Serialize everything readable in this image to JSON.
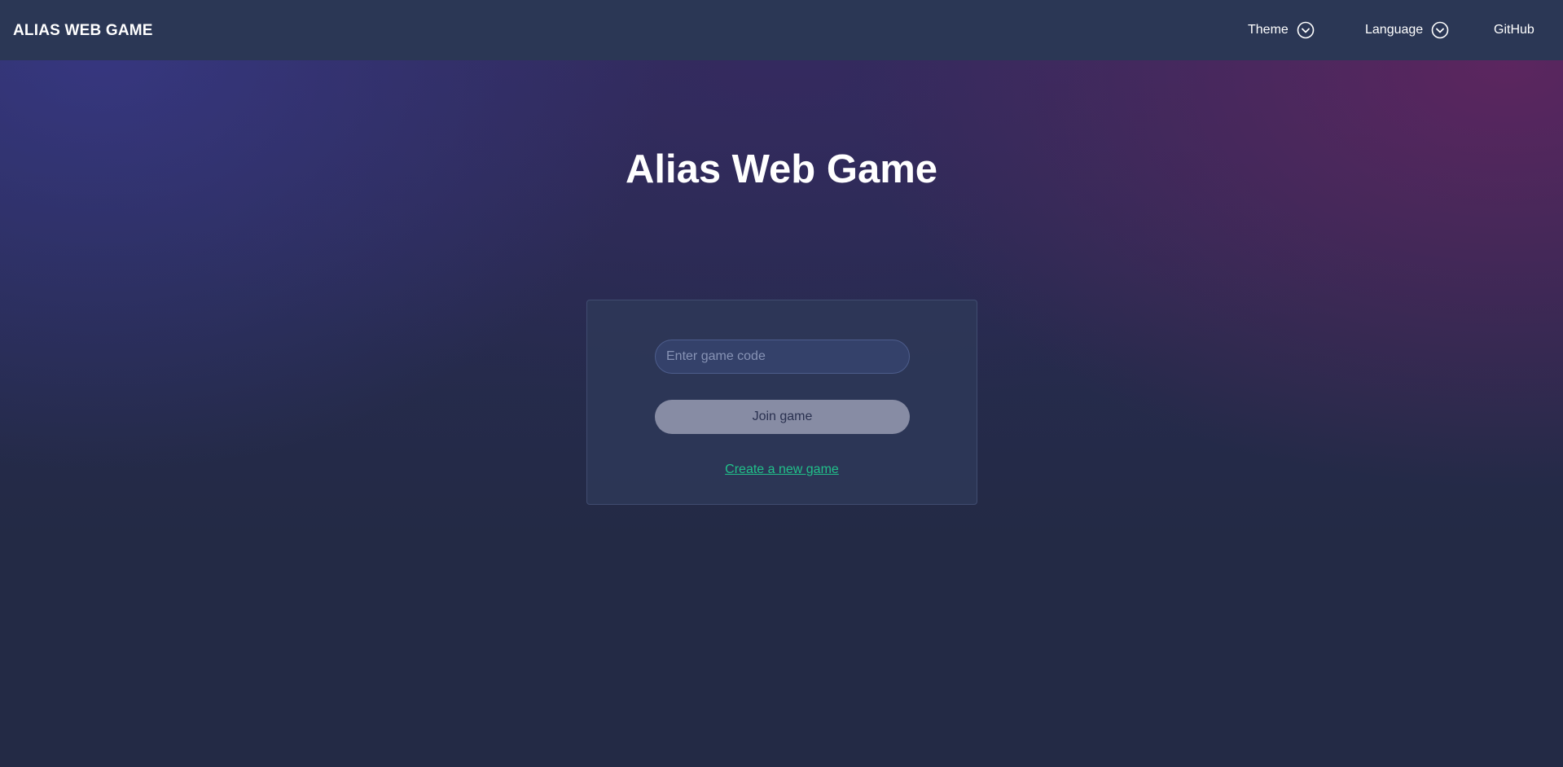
{
  "navbar": {
    "brand": "ALIAS WEB GAME",
    "theme_label": "Theme",
    "language_label": "Language",
    "github_label": "GitHub"
  },
  "main": {
    "title": "Alias Web Game",
    "game_code_placeholder": "Enter game code",
    "game_code_value": "",
    "join_button_label": "Join game",
    "create_link_label": "Create a new game"
  },
  "colors": {
    "navbar_bg": "#2b3755",
    "page_bg": "#232a45",
    "card_bg": "#2d3858",
    "input_bg": "#34416a",
    "button_bg": "#878ca4",
    "link": "#21c08a"
  },
  "icons": {
    "theme_dropdown": "chevron-down-circle-icon",
    "language_dropdown": "chevron-down-circle-icon"
  }
}
